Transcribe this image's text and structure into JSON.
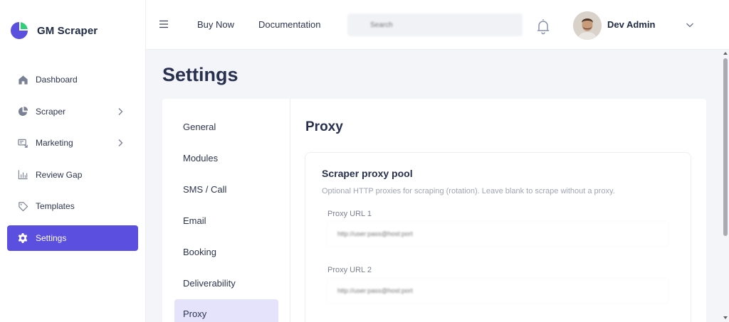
{
  "brand": {
    "name": "GM Scraper",
    "logo_icon": "gm-scraper-logo",
    "primary_color": "#5b4fe0"
  },
  "sidebar": {
    "items": [
      {
        "label": "Dashboard",
        "icon": "home-icon",
        "has_submenu": false,
        "active": false
      },
      {
        "label": "Scraper",
        "icon": "pie-chart-icon",
        "has_submenu": true,
        "active": false
      },
      {
        "label": "Marketing",
        "icon": "megaphone-icon",
        "has_submenu": true,
        "active": false
      },
      {
        "label": "Review Gap",
        "icon": "bar-chart-icon",
        "has_submenu": false,
        "active": false
      },
      {
        "label": "Templates",
        "icon": "tag-icon",
        "has_submenu": false,
        "active": false
      },
      {
        "label": "Settings",
        "icon": "gear-icon",
        "has_submenu": false,
        "active": true
      }
    ]
  },
  "topbar": {
    "links": [
      "Buy Now",
      "Documentation"
    ],
    "search_placeholder": "Search",
    "user_name": "Dev Admin"
  },
  "page": {
    "title": "Settings"
  },
  "settings_nav": {
    "items": [
      "General",
      "Modules",
      "SMS / Call",
      "Email",
      "Booking",
      "Deliverability",
      "Proxy"
    ],
    "active": "Proxy"
  },
  "proxy": {
    "section_title": "Proxy",
    "pool_title": "Scraper proxy pool",
    "pool_description": "Optional HTTP proxies for scraping (rotation). Leave blank to scrape without a proxy.",
    "fields": [
      {
        "label": "Proxy URL 1",
        "placeholder": "http://user:pass@host:port",
        "value": ""
      },
      {
        "label": "Proxy URL 2",
        "placeholder": "http://user:pass@host:port",
        "value": ""
      }
    ]
  }
}
